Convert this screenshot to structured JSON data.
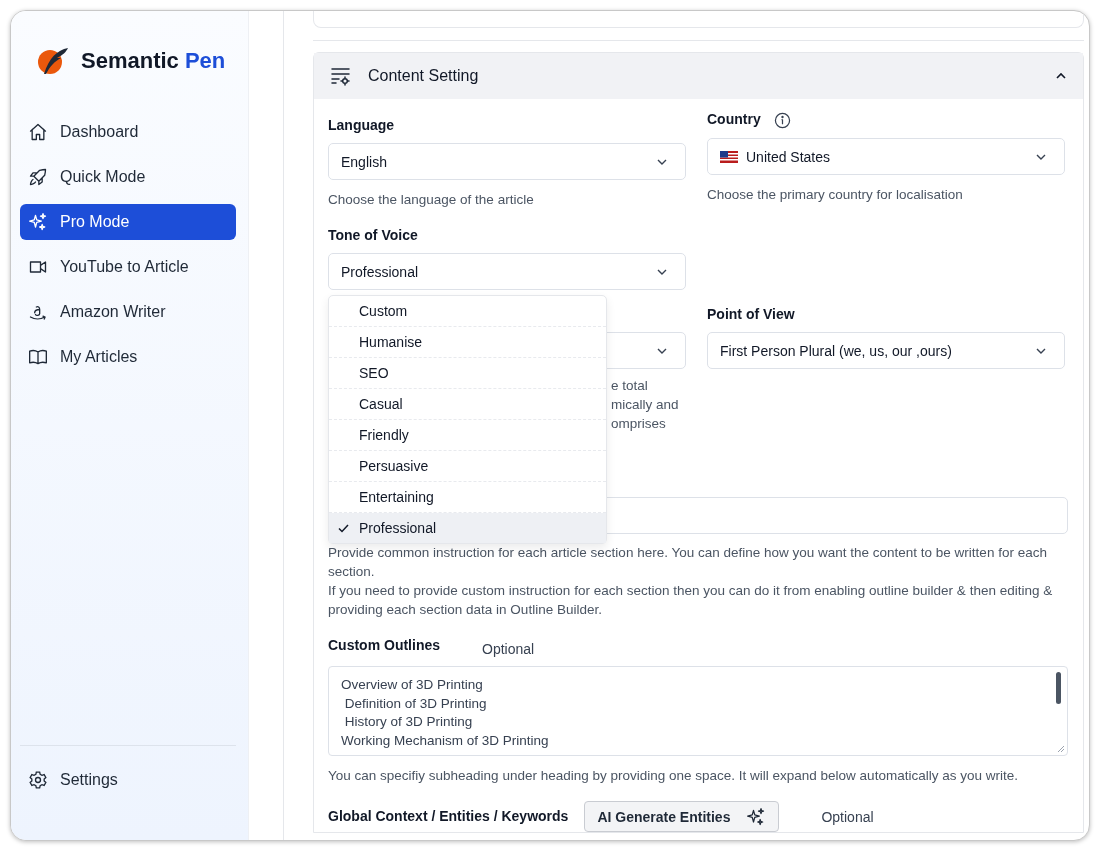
{
  "sidebar": {
    "brand": {
      "name": "Semantic",
      "accent": "Pen"
    },
    "items": [
      {
        "label": "Dashboard",
        "selected": false
      },
      {
        "label": "Quick Mode",
        "selected": false
      },
      {
        "label": "Pro Mode",
        "selected": true
      },
      {
        "label": "YouTube to Article",
        "selected": false
      },
      {
        "label": "Amazon Writer",
        "selected": false
      },
      {
        "label": "My Articles",
        "selected": false
      }
    ],
    "footer_item": {
      "label": "Settings"
    }
  },
  "content_setting": {
    "title": "Content Setting",
    "expanded": true,
    "language": {
      "label": "Language",
      "value": "English",
      "helper": "Choose the language of the article"
    },
    "country": {
      "label": "Country",
      "value": "United States",
      "helper": "Choose the primary country for localisation"
    },
    "tone_of_voice": {
      "label": "Tone of Voice",
      "value": "Professional",
      "expanded": true,
      "options": [
        {
          "label": "Custom",
          "selected": false
        },
        {
          "label": "Humanise",
          "selected": false
        },
        {
          "label": "SEO",
          "selected": false
        },
        {
          "label": "Casual",
          "selected": false
        },
        {
          "label": "Friendly",
          "selected": false
        },
        {
          "label": "Persuasive",
          "selected": false
        },
        {
          "label": "Entertaining",
          "selected": false
        },
        {
          "label": "Professional",
          "selected": true
        }
      ]
    },
    "field_4": {
      "helper_fragments": [
        "e total",
        "mically and",
        "omprises"
      ]
    },
    "point_of_view": {
      "label": "Point of View",
      "value": "First Person Plural (we, us, our ,ours)"
    },
    "field_6": {
      "helper": [
        "Provide common instruction for each article section here. You can define how you want the content to be written for each section.",
        "If you need to provide custom instruction for each section then you can do it from enabling outline builder & then editing & providing each section data in Outline Builder."
      ]
    },
    "custom_outlines": {
      "label": "Custom Outlines",
      "optional": "Optional",
      "lines": [
        "Overview of 3D Printing",
        " Definition of 3D Printing",
        " History of 3D Printing",
        "Working Mechanism of 3D Printing"
      ],
      "helper": "You can specifiy subheading under heading by providing one space. It will expand below automatically as you write."
    },
    "global_context": {
      "label": "Global Context / Entities / Keywords",
      "button": "AI Generate Entities",
      "optional": "Optional"
    }
  }
}
